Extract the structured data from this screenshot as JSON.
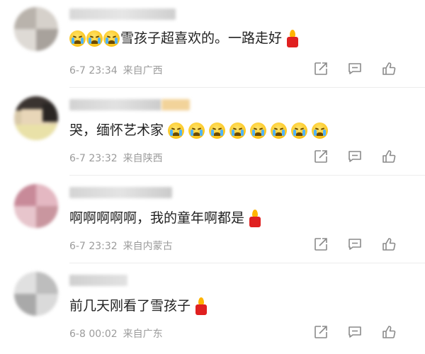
{
  "comments": [
    {
      "text": "雪孩子超喜欢的。一路走好",
      "time": "6-7 23:34",
      "location": "来自广西",
      "emojis_before": [
        "crying-face",
        "crying-face",
        "crying-face"
      ],
      "emojis_after": [
        "candle"
      ]
    },
    {
      "text": "哭，缅怀艺术家",
      "time": "6-7 23:32",
      "location": "来自陕西",
      "emojis_before": [],
      "emojis_after": [
        "crying-face",
        "crying-face",
        "crying-face",
        "crying-face",
        "crying-face",
        "crying-face",
        "crying-face",
        "crying-face"
      ]
    },
    {
      "text": "啊啊啊啊啊，我的童年啊都是",
      "time": "6-7 23:32",
      "location": "来自内蒙古",
      "emojis_before": [],
      "emojis_after": [
        "candle"
      ]
    },
    {
      "text": "前几天刚看了雪孩子",
      "time": "6-8 00:02",
      "location": "来自广东",
      "emojis_before": [],
      "emojis_after": [
        "candle"
      ]
    }
  ],
  "actions": [
    "share-icon",
    "comment-icon",
    "like-icon"
  ],
  "colors": {
    "text": "#222222",
    "meta": "#9b9b9b",
    "candle": "#e02020",
    "emoji": "#fcc419"
  }
}
